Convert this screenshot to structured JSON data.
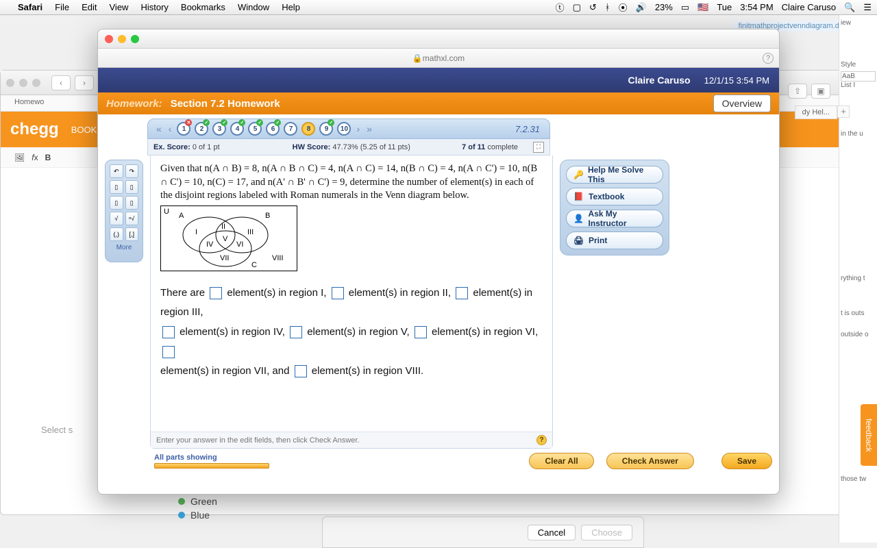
{
  "mac_menu": {
    "app": "Safari",
    "items": [
      "File",
      "Edit",
      "View",
      "History",
      "Bookmarks",
      "Window",
      "Help"
    ],
    "battery": "23%",
    "day": "Tue",
    "time": "3:54 PM",
    "user": "Claire Caruso"
  },
  "doc_tab": "finitmathprojectvenndiagram.docx",
  "bg": {
    "chegg": "chegg",
    "chegg_sub": "BOOK",
    "tab": "Homewo",
    "select": "Select s",
    "green": "Green",
    "blue": "Blue",
    "tabs_right": "dy Hel..."
  },
  "word": {
    "review": "iew",
    "style": "Style",
    "aab": "AaB",
    "list": "List I",
    "u1": "in the u",
    "u2": "rything t",
    "u3": "t is outs",
    "u4": "outside o",
    "u5": "those tw"
  },
  "sheet": {
    "cancel": "Cancel",
    "choose": "Choose"
  },
  "feedback": "feedback",
  "popup": {
    "domain": "mathxl.com",
    "user": "Claire Caruso",
    "datetime": "12/1/15 3:54 PM",
    "hw_label": "Homework:",
    "hw_title": "Section 7.2 Homework",
    "overview": "Overview",
    "qnum": "7.2.31",
    "pills": [
      "1",
      "2",
      "3",
      "4",
      "5",
      "6",
      "7",
      "8",
      "9",
      "10"
    ],
    "ex_label": "Ex. Score:",
    "ex_val": "0 of 1 pt",
    "hw_score_label": "HW Score:",
    "hw_score_val": "47.73% (5.25 of 11 pts)",
    "progress": "7 of 11",
    "complete": "complete",
    "question": "Given that n(A ∩ B) = 8, n(A ∩ B ∩ C) = 4, n(A ∩ C)  = 14, n(B ∩ C) = 4,  n(A ∩ C') = 10, n(B ∩ C') = 10, n(C) = 17, and n(A' ∩ B' ∩ C') = 9, determine the number of element(s) in each of the disjoint regions labeled with Roman numerals in the Venn diagram below.",
    "venn": {
      "U": "U",
      "A": "A",
      "B": "B",
      "C": "C",
      "I": "I",
      "II": "II",
      "III": "III",
      "IV": "IV",
      "V": "V",
      "VI": "VI",
      "VII": "VII",
      "VIII": "VIII"
    },
    "answer_parts": {
      "p1": "There are ",
      "p2": " element(s) in region I, ",
      "p3": " element(s) in region II, ",
      "p4": " element(s) in region III, ",
      "p5": " element(s) in region IV, ",
      "p6": " element(s) in region V, ",
      "p7": " element(s) in region VI, ",
      "p8": " element(s) in region VII, and ",
      "p9": " element(s) in region VIII."
    },
    "hint": "Enter your answer in the edit fields, then click Check Answer.",
    "parts_showing": "All parts showing",
    "clear": "Clear All",
    "check": "Check Answer",
    "save": "Save",
    "help": {
      "solve": "Help Me Solve This",
      "textbook": "Textbook",
      "ask": "Ask My Instructor",
      "print": "Print"
    },
    "palette_more": "More"
  }
}
